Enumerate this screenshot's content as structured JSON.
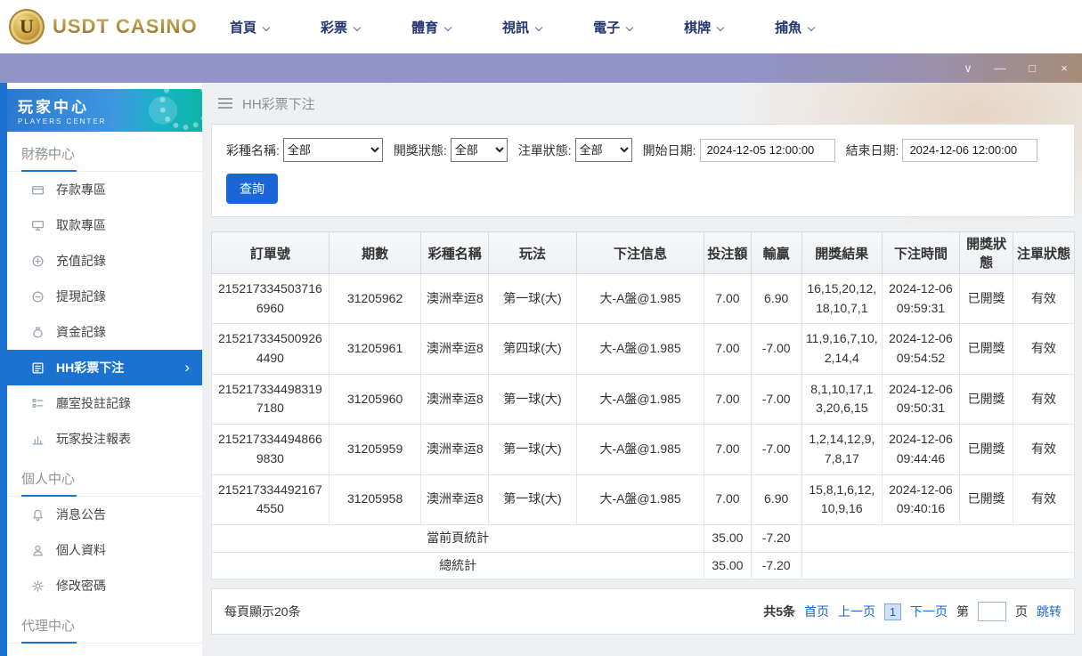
{
  "topnav": {
    "logo_text": "USDT CASINO",
    "logo_letter": "U",
    "items": [
      {
        "label": "首頁"
      },
      {
        "label": "彩票"
      },
      {
        "label": "體育"
      },
      {
        "label": "視訊"
      },
      {
        "label": "電子"
      },
      {
        "label": "棋牌"
      },
      {
        "label": "捕魚"
      }
    ]
  },
  "titlebar": {
    "controls": [
      {
        "icon": "chevron-down-icon",
        "glyph": "∨"
      },
      {
        "icon": "minimize-icon",
        "glyph": "—"
      },
      {
        "icon": "maximize-icon",
        "glyph": "□"
      },
      {
        "icon": "close-icon",
        "glyph": "×"
      }
    ]
  },
  "sidebar": {
    "title": "玩家中心",
    "subtitle": "PLAYERS CENTER",
    "sections": [
      {
        "title": "財務中心",
        "items": [
          {
            "label": "存款專區",
            "icon": "deposit-icon"
          },
          {
            "label": "取款專區",
            "icon": "withdraw-icon"
          },
          {
            "label": "充值記錄",
            "icon": "recharge-record-icon"
          },
          {
            "label": "提現記錄",
            "icon": "cashout-record-icon"
          },
          {
            "label": "資金記錄",
            "icon": "funds-record-icon"
          },
          {
            "label": "HH彩票下注",
            "icon": "lottery-bet-icon",
            "active": true
          },
          {
            "label": "廳室投註記錄",
            "icon": "hall-bet-record-icon"
          },
          {
            "label": "玩家投注報表",
            "icon": "player-report-icon"
          }
        ]
      },
      {
        "title": "個人中心",
        "items": [
          {
            "label": "消息公告",
            "icon": "announcement-icon"
          },
          {
            "label": "個人資料",
            "icon": "profile-icon"
          },
          {
            "label": "修改密碼",
            "icon": "password-icon"
          }
        ]
      },
      {
        "title": "代理中心",
        "items": []
      }
    ]
  },
  "breadcrumb": {
    "title": "HH彩票下注"
  },
  "filters": {
    "lottery_label": "彩種名稱:",
    "lottery_value": "全部",
    "draw_status_label": "開獎狀態:",
    "draw_status_value": "全部",
    "order_status_label": "注單狀態:",
    "order_status_value": "全部",
    "start_date_label": "開始日期:",
    "start_date_value": "2024-12-05 12:00:00",
    "end_date_label": "結束日期:",
    "end_date_value": "2024-12-06 12:00:00",
    "search_button": "查詢"
  },
  "table": {
    "columns": [
      {
        "key": "order_no",
        "label": "訂單號"
      },
      {
        "key": "period",
        "label": "期數"
      },
      {
        "key": "lottery",
        "label": "彩種名稱"
      },
      {
        "key": "play",
        "label": "玩法"
      },
      {
        "key": "bet_info",
        "label": "下注信息"
      },
      {
        "key": "amount",
        "label": "投注額"
      },
      {
        "key": "winloss",
        "label": "輸贏"
      },
      {
        "key": "result",
        "label": "開獎結果"
      },
      {
        "key": "time",
        "label": "下注時間"
      },
      {
        "key": "draw_status",
        "label": "開獎狀態"
      },
      {
        "key": "order_status",
        "label": "注單狀態"
      }
    ],
    "rows": [
      {
        "order_no": "2152173345037166960",
        "period": "31205962",
        "lottery": "澳洲幸运8",
        "play": "第一球(大)",
        "bet_info": "大-A盤@1.985",
        "amount": "7.00",
        "winloss": "6.90",
        "result": "16,15,20,12,18,10,7,1",
        "time": "2024-12-06 09:59:31",
        "draw_status": "已開獎",
        "order_status": "有效"
      },
      {
        "order_no": "2152173345009264490",
        "period": "31205961",
        "lottery": "澳洲幸运8",
        "play": "第四球(大)",
        "bet_info": "大-A盤@1.985",
        "amount": "7.00",
        "winloss": "-7.00",
        "result": "11,9,16,7,10,2,14,4",
        "time": "2024-12-06 09:54:52",
        "draw_status": "已開獎",
        "order_status": "有效"
      },
      {
        "order_no": "2152173344983197180",
        "period": "31205960",
        "lottery": "澳洲幸运8",
        "play": "第一球(大)",
        "bet_info": "大-A盤@1.985",
        "amount": "7.00",
        "winloss": "-7.00",
        "result": "8,1,10,17,13,20,6,15",
        "time": "2024-12-06 09:50:31",
        "draw_status": "已開獎",
        "order_status": "有效"
      },
      {
        "order_no": "2152173344948669830",
        "period": "31205959",
        "lottery": "澳洲幸运8",
        "play": "第一球(大)",
        "bet_info": "大-A盤@1.985",
        "amount": "7.00",
        "winloss": "-7.00",
        "result": "1,2,14,12,9,7,8,17",
        "time": "2024-12-06 09:44:46",
        "draw_status": "已開獎",
        "order_status": "有效"
      },
      {
        "order_no": "2152173344921674550",
        "period": "31205958",
        "lottery": "澳洲幸运8",
        "play": "第一球(大)",
        "bet_info": "大-A盤@1.985",
        "amount": "7.00",
        "winloss": "6.90",
        "result": "15,8,1,6,12,10,9,16",
        "time": "2024-12-06 09:40:16",
        "draw_status": "已開獎",
        "order_status": "有效"
      }
    ],
    "page_total": {
      "label": "當前頁統計",
      "amount": "35.00",
      "winloss": "-7.20"
    },
    "grand_total": {
      "label": "總統計",
      "amount": "35.00",
      "winloss": "-7.20"
    }
  },
  "pagination": {
    "per_page": "每頁顯示20条",
    "total": "共5条",
    "first": "首页",
    "prev": "上一页",
    "current": "1",
    "next": "下一页",
    "page_prefix": "第",
    "page_suffix": "页",
    "jump": "跳转",
    "jump_value": ""
  },
  "colors": {
    "accent_blue": "#1b72d0",
    "titlebar_purple": "#9094c7",
    "logo_gold": "#b08a2e",
    "banner_teal": "#0cb4a4"
  }
}
